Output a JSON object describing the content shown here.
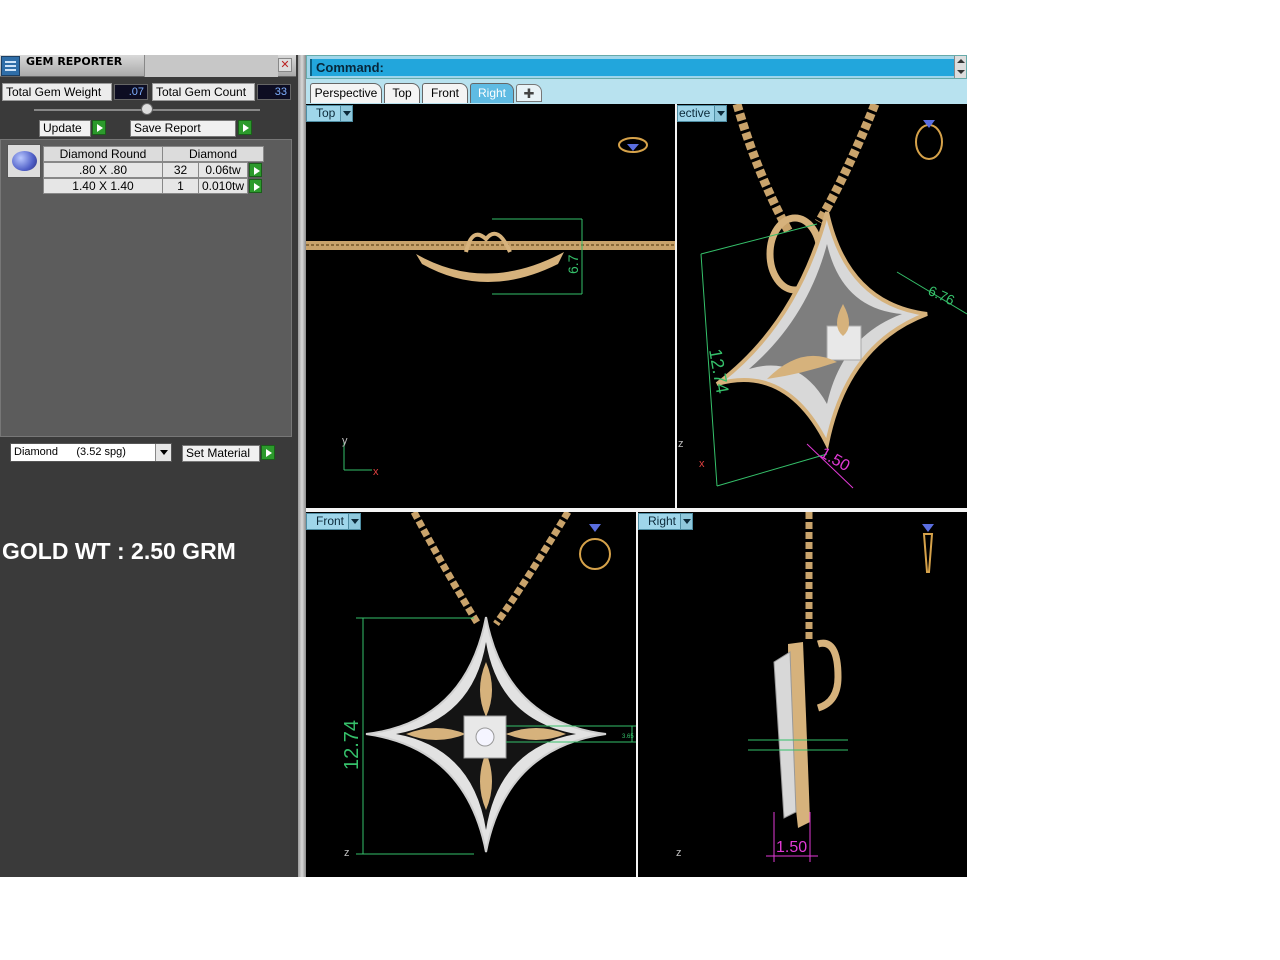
{
  "gem_reporter": {
    "title": "GEM REPORTER",
    "close_icon": "close-icon",
    "total_gem_weight_label": "Total Gem Weight",
    "total_gem_weight_value": ".07",
    "total_gem_count_label": "Total Gem Count",
    "total_gem_count_value": "33",
    "update_label": "Update",
    "save_report_label": "Save Report",
    "table": {
      "headers": [
        "Diamond Round",
        "Diamond"
      ],
      "rows": [
        {
          "size": ".80 X .80",
          "count": "32",
          "weight": "0.06tw"
        },
        {
          "size": "1.40 X 1.40",
          "count": "1",
          "weight": "0.010tw"
        }
      ]
    },
    "material_selected": "Diamond      (3.52 spg)",
    "set_material_label": "Set Material",
    "gold_weight_text": "GOLD WT : 2.50 GRM"
  },
  "command": {
    "label": "Command:"
  },
  "tabs": [
    {
      "label": "Perspective",
      "active": false
    },
    {
      "label": "Top",
      "active": false
    },
    {
      "label": "Front",
      "active": false
    },
    {
      "label": "Right",
      "active": true
    }
  ],
  "viewports": {
    "top": {
      "label": "Top",
      "dimension": "6.7",
      "axis_x": "x",
      "axis_y": "y"
    },
    "perspective": {
      "label": "ective",
      "dim_width": "6.76",
      "dim_height": "12.74",
      "dim_thickness": "1.50",
      "axis_z": "z",
      "axis_x": "x"
    },
    "front": {
      "label": "Front",
      "dimension": "12.74",
      "small_dim": "3.65",
      "axis_z": "z"
    },
    "right": {
      "label": "Right",
      "dimension": "1.50",
      "axis_z": "z"
    }
  },
  "colors": {
    "panel_bg": "#3a3a3a",
    "command_bar": "#22a6dc",
    "active_tab": "#5fbbe3",
    "gold": "#d8b27a",
    "dimension_green": "#35c06a",
    "dimension_magenta": "#e23ad6"
  }
}
